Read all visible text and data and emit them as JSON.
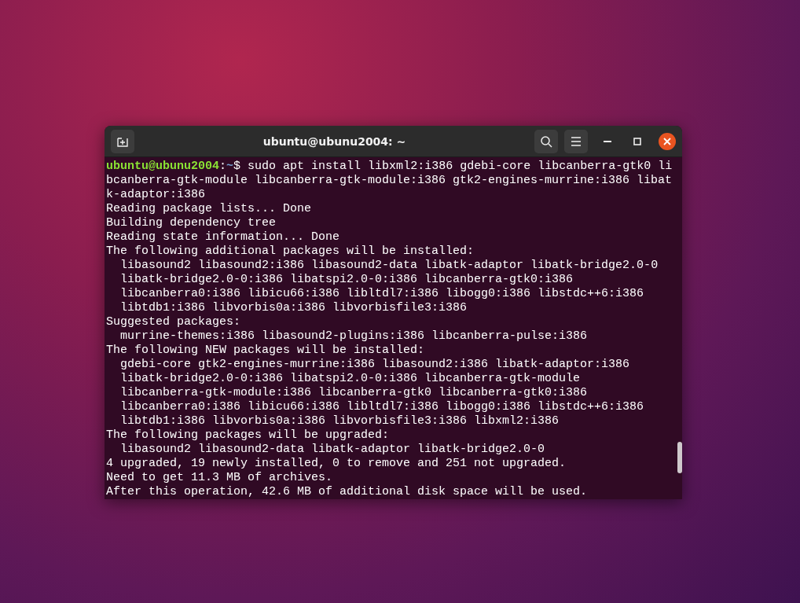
{
  "window": {
    "title": "ubuntu@ubunu2004: ~"
  },
  "prompt": {
    "user_host": "ubuntu@ubunu2004",
    "separator": ":",
    "path": "~",
    "symbol": "$",
    "command": "sudo apt install libxml2:i386 gdebi-core libcanberra-gtk0 libcanberra-gtk-module libcanberra-gtk-module:i386 gtk2-engines-murrine:i386 libatk-adaptor:i386"
  },
  "output": [
    "Reading package lists... Done",
    "Building dependency tree",
    "Reading state information... Done",
    "The following additional packages will be installed:",
    "  libasound2 libasound2:i386 libasound2-data libatk-adaptor libatk-bridge2.0-0",
    "  libatk-bridge2.0-0:i386 libatspi2.0-0:i386 libcanberra-gtk0:i386",
    "  libcanberra0:i386 libicu66:i386 libltdl7:i386 libogg0:i386 libstdc++6:i386",
    "  libtdb1:i386 libvorbis0a:i386 libvorbisfile3:i386",
    "Suggested packages:",
    "  murrine-themes:i386 libasound2-plugins:i386 libcanberra-pulse:i386",
    "The following NEW packages will be installed:",
    "  gdebi-core gtk2-engines-murrine:i386 libasound2:i386 libatk-adaptor:i386",
    "  libatk-bridge2.0-0:i386 libatspi2.0-0:i386 libcanberra-gtk-module",
    "  libcanberra-gtk-module:i386 libcanberra-gtk0 libcanberra-gtk0:i386",
    "  libcanberra0:i386 libicu66:i386 libltdl7:i386 libogg0:i386 libstdc++6:i386",
    "  libtdb1:i386 libvorbis0a:i386 libvorbisfile3:i386 libxml2:i386",
    "The following packages will be upgraded:",
    "  libasound2 libasound2-data libatk-adaptor libatk-bridge2.0-0",
    "4 upgraded, 19 newly installed, 0 to remove and 251 not upgraded.",
    "Need to get 11.3 MB of archives.",
    "After this operation, 42.6 MB of additional disk space will be used."
  ]
}
